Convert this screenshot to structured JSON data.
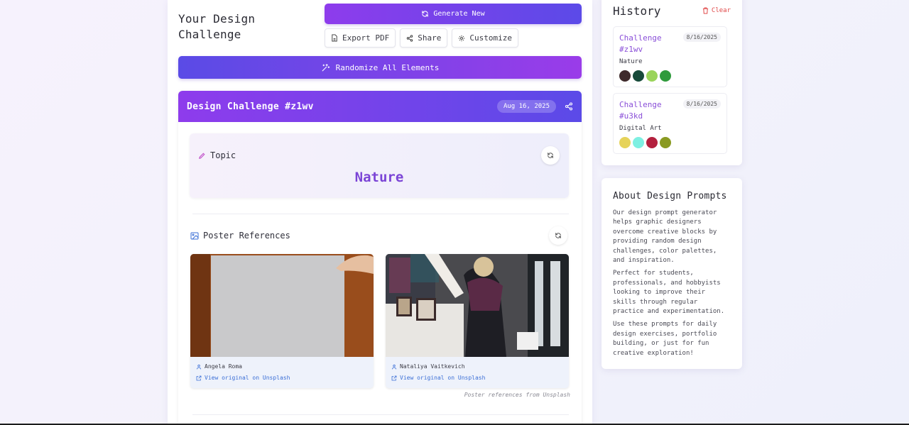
{
  "header": {
    "title_line1": "Your Design",
    "title_line2": "Challenge",
    "generate_label": "Generate New",
    "export_label": "Export PDF",
    "share_label": "Share",
    "customize_label": "Customize",
    "randomize_label": "Randomize All Elements"
  },
  "challenge": {
    "title": "Design Challenge #z1wv",
    "date": "Aug 16, 2025",
    "topic_label": "Topic",
    "topic_value": "Nature",
    "poster_label": "Poster References",
    "posters": [
      {
        "author": "Angela Roma",
        "link_text": "View original on Unsplash"
      },
      {
        "author": "Nataliya Vaitkevich",
        "link_text": "View original on Unsplash"
      }
    ],
    "source_note": "Poster references from Unsplash"
  },
  "history": {
    "title": "History",
    "clear_label": "Clear",
    "items": [
      {
        "name": "Challenge #z1wv",
        "date": "8/16/2025",
        "category": "Nature",
        "colors": [
          "#3f2a2c",
          "#174a3a",
          "#9ad45a",
          "#2f9a3c"
        ]
      },
      {
        "name": "Challenge #u3kd",
        "date": "8/16/2025",
        "category": "Digital Art",
        "colors": [
          "#e6d35a",
          "#7ef0e2",
          "#b3203e",
          "#8a9a22"
        ]
      }
    ]
  },
  "about": {
    "title": "About Design Prompts",
    "p1": "Our design prompt generator helps graphic designers overcome creative blocks by providing random design challenges, color palettes, and inspiration.",
    "p2": "Perfect for students, professionals, and hobbyists looking to improve their skills through regular practice and experimentation.",
    "p3": "Use these prompts for daily design exercises, portfolio building, or just for fun creative exploration!"
  },
  "colors": {
    "accent_purple": "#8e3cec",
    "accent_indigo": "#5b4ae8",
    "topic_text": "#7b44d6",
    "clear_red": "#e04848"
  }
}
